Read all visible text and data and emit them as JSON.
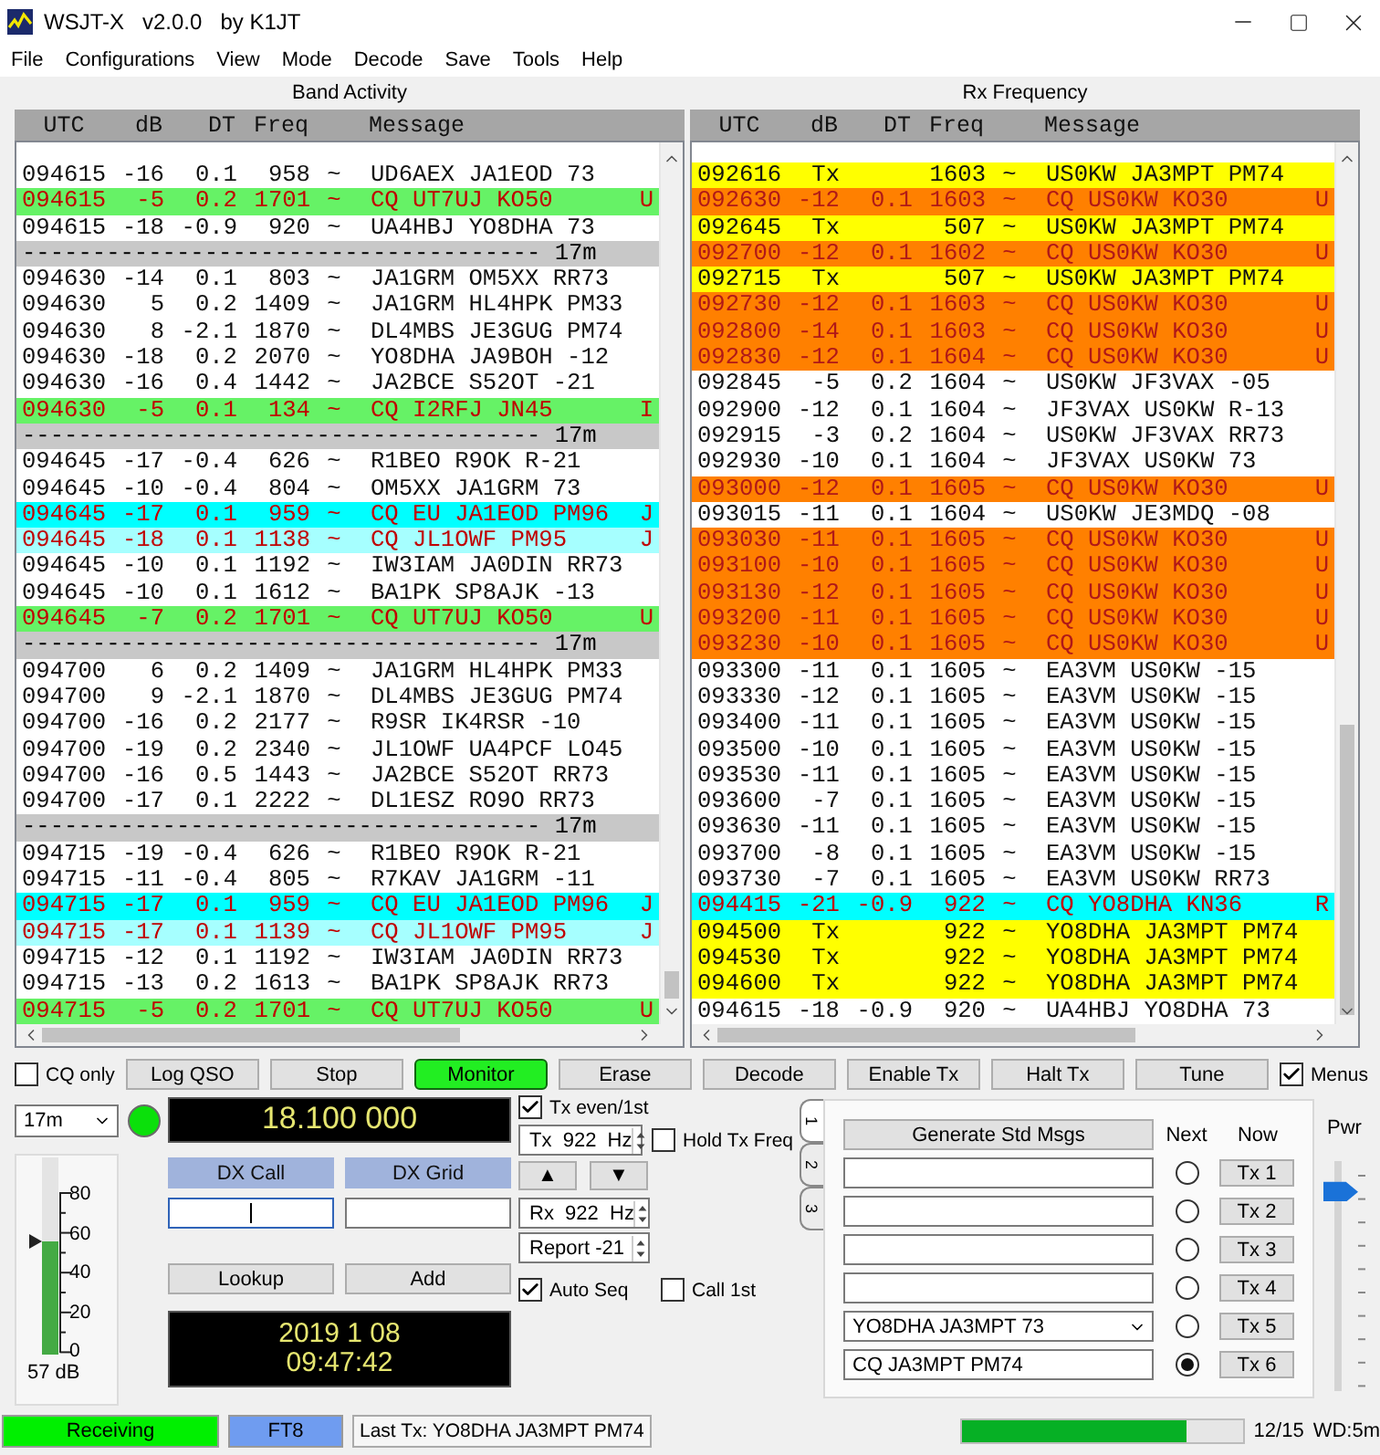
{
  "window": {
    "title": "WSJT-X   v2.0.0   by K1JT"
  },
  "menu": [
    "File",
    "Configurations",
    "View",
    "Mode",
    "Decode",
    "Save",
    "Tools",
    "Help"
  ],
  "panels": [
    {
      "title": "Band Activity",
      "columns": [
        "UTC",
        "dB",
        "DT",
        "Freq",
        "Message"
      ],
      "rows": [
        {
          "kind": "plain",
          "utc": "094615",
          "db": "-16",
          "dt": "0.1",
          "freq": "958",
          "mark": "~",
          "message": "UD6AEX JA1EOD 73"
        },
        {
          "kind": "cq",
          "utc": "094615",
          "db": "-5",
          "dt": "0.2",
          "freq": "1701",
          "mark": "~",
          "message": "CQ UT7UJ KO50",
          "tail": "U"
        },
        {
          "kind": "plain",
          "utc": "094615",
          "db": "-18",
          "dt": "-0.9",
          "freq": "920",
          "mark": "~",
          "message": "UA4HBJ YO8DHA 73"
        },
        {
          "kind": "separator",
          "text": "------------------------------------- 17m"
        },
        {
          "kind": "plain",
          "utc": "094630",
          "db": "-14",
          "dt": "0.1",
          "freq": "803",
          "mark": "~",
          "message": "JA1GRM OM5XX RR73"
        },
        {
          "kind": "plain",
          "utc": "094630",
          "db": "5",
          "dt": "0.2",
          "freq": "1409",
          "mark": "~",
          "message": "JA1GRM HL4HPK PM33"
        },
        {
          "kind": "plain",
          "utc": "094630",
          "db": "8",
          "dt": "-2.1",
          "freq": "1870",
          "mark": "~",
          "message": "DL4MBS JE3GUG PM74"
        },
        {
          "kind": "plain",
          "utc": "094630",
          "db": "-18",
          "dt": "0.2",
          "freq": "2070",
          "mark": "~",
          "message": "YO8DHA JA9BOH -12"
        },
        {
          "kind": "plain",
          "utc": "094630",
          "db": "-16",
          "dt": "0.4",
          "freq": "1442",
          "mark": "~",
          "message": "JA2BCE S52OT -21"
        },
        {
          "kind": "cq",
          "utc": "094630",
          "db": "-5",
          "dt": "0.1",
          "freq": "134",
          "mark": "~",
          "message": "CQ I2RFJ JN45",
          "tail": "I"
        },
        {
          "kind": "separator",
          "text": "------------------------------------- 17m"
        },
        {
          "kind": "plain",
          "utc": "094645",
          "db": "-17",
          "dt": "-0.4",
          "freq": "626",
          "mark": "~",
          "message": "R1BEO R9OK R-21"
        },
        {
          "kind": "plain",
          "utc": "094645",
          "db": "-10",
          "dt": "-0.4",
          "freq": "804",
          "mark": "~",
          "message": "OM5XX JA1GRM 73"
        },
        {
          "kind": "dxcc",
          "utc": "094645",
          "db": "-17",
          "dt": "0.1",
          "freq": "959",
          "mark": "~",
          "message": "CQ EU JA1EOD PM96",
          "tail": "J"
        },
        {
          "kind": "call",
          "utc": "094645",
          "db": "-18",
          "dt": "0.1",
          "freq": "1138",
          "mark": "~",
          "message": "CQ JL1OWF PM95",
          "tail": "J"
        },
        {
          "kind": "plain",
          "utc": "094645",
          "db": "-10",
          "dt": "0.1",
          "freq": "1192",
          "mark": "~",
          "message": "IW3IAM JA0DIN RR73"
        },
        {
          "kind": "plain",
          "utc": "094645",
          "db": "-10",
          "dt": "0.1",
          "freq": "1612",
          "mark": "~",
          "message": "BA1PK SP8AJK -13"
        },
        {
          "kind": "cq",
          "utc": "094645",
          "db": "-7",
          "dt": "0.2",
          "freq": "1701",
          "mark": "~",
          "message": "CQ UT7UJ KO50",
          "tail": "U"
        },
        {
          "kind": "separator",
          "text": "------------------------------------- 17m"
        },
        {
          "kind": "plain",
          "utc": "094700",
          "db": "6",
          "dt": "0.2",
          "freq": "1409",
          "mark": "~",
          "message": "JA1GRM HL4HPK PM33"
        },
        {
          "kind": "plain",
          "utc": "094700",
          "db": "9",
          "dt": "-2.1",
          "freq": "1870",
          "mark": "~",
          "message": "DL4MBS JE3GUG PM74"
        },
        {
          "kind": "plain",
          "utc": "094700",
          "db": "-16",
          "dt": "0.2",
          "freq": "2177",
          "mark": "~",
          "message": "R9SR IK4RSR -10"
        },
        {
          "kind": "plain",
          "utc": "094700",
          "db": "-19",
          "dt": "0.2",
          "freq": "2340",
          "mark": "~",
          "message": "JL1OWF UA4PCF LO45"
        },
        {
          "kind": "plain",
          "utc": "094700",
          "db": "-16",
          "dt": "0.5",
          "freq": "1443",
          "mark": "~",
          "message": "JA2BCE S52OT RR73"
        },
        {
          "kind": "plain",
          "utc": "094700",
          "db": "-17",
          "dt": "0.1",
          "freq": "2222",
          "mark": "~",
          "message": "DL1ESZ RO9O RR73"
        },
        {
          "kind": "separator",
          "text": "------------------------------------- 17m"
        },
        {
          "kind": "plain",
          "utc": "094715",
          "db": "-19",
          "dt": "-0.4",
          "freq": "626",
          "mark": "~",
          "message": "R1BEO R9OK R-21"
        },
        {
          "kind": "plain",
          "utc": "094715",
          "db": "-11",
          "dt": "-0.4",
          "freq": "805",
          "mark": "~",
          "message": "R7KAV JA1GRM -11"
        },
        {
          "kind": "dxcc",
          "utc": "094715",
          "db": "-17",
          "dt": "0.1",
          "freq": "959",
          "mark": "~",
          "message": "CQ EU JA1EOD PM96",
          "tail": "J"
        },
        {
          "kind": "call",
          "utc": "094715",
          "db": "-17",
          "dt": "0.1",
          "freq": "1139",
          "mark": "~",
          "message": "CQ JL1OWF PM95",
          "tail": "J"
        },
        {
          "kind": "plain",
          "utc": "094715",
          "db": "-12",
          "dt": "0.1",
          "freq": "1192",
          "mark": "~",
          "message": "IW3IAM JA0DIN RR73"
        },
        {
          "kind": "plain",
          "utc": "094715",
          "db": "-13",
          "dt": "0.2",
          "freq": "1613",
          "mark": "~",
          "message": "BA1PK SP8AJK RR73"
        },
        {
          "kind": "cq",
          "utc": "094715",
          "db": "-5",
          "dt": "0.2",
          "freq": "1701",
          "mark": "~",
          "message": "CQ UT7UJ KO50",
          "tail": "U"
        }
      ]
    },
    {
      "title": "Rx Frequency",
      "columns": [
        "UTC",
        "dB",
        "DT",
        "Freq",
        "Message"
      ],
      "rows": [
        {
          "kind": "tx",
          "utc": "092616",
          "db": "Tx",
          "freq": "1603",
          "mark": "~",
          "message": "US0KW JA3MPT PM74"
        },
        {
          "kind": "watch",
          "utc": "092630",
          "db": "-12",
          "dt": "0.1",
          "freq": "1603",
          "mark": "~",
          "message": "CQ US0KW KO30",
          "tail": "U"
        },
        {
          "kind": "tx",
          "utc": "092645",
          "db": "Tx",
          "freq": "507",
          "mark": "~",
          "message": "US0KW JA3MPT PM74"
        },
        {
          "kind": "watch",
          "utc": "092700",
          "db": "-12",
          "dt": "0.1",
          "freq": "1602",
          "mark": "~",
          "message": "CQ US0KW KO30",
          "tail": "U"
        },
        {
          "kind": "tx",
          "utc": "092715",
          "db": "Tx",
          "freq": "507",
          "mark": "~",
          "message": "US0KW JA3MPT PM74"
        },
        {
          "kind": "watch",
          "utc": "092730",
          "db": "-12",
          "dt": "0.1",
          "freq": "1603",
          "mark": "~",
          "message": "CQ US0KW KO30",
          "tail": "U"
        },
        {
          "kind": "watch",
          "utc": "092800",
          "db": "-14",
          "dt": "0.1",
          "freq": "1603",
          "mark": "~",
          "message": "CQ US0KW KO30",
          "tail": "U"
        },
        {
          "kind": "watch",
          "utc": "092830",
          "db": "-12",
          "dt": "0.1",
          "freq": "1604",
          "mark": "~",
          "message": "CQ US0KW KO30",
          "tail": "U"
        },
        {
          "kind": "plain",
          "utc": "092845",
          "db": "-5",
          "dt": "0.2",
          "freq": "1604",
          "mark": "~",
          "message": "US0KW JF3VAX -05"
        },
        {
          "kind": "plain",
          "utc": "092900",
          "db": "-12",
          "dt": "0.1",
          "freq": "1604",
          "mark": "~",
          "message": "JF3VAX US0KW R-13"
        },
        {
          "kind": "plain",
          "utc": "092915",
          "db": "-3",
          "dt": "0.2",
          "freq": "1604",
          "mark": "~",
          "message": "US0KW JF3VAX RR73"
        },
        {
          "kind": "plain",
          "utc": "092930",
          "db": "-10",
          "dt": "0.1",
          "freq": "1604",
          "mark": "~",
          "message": "JF3VAX US0KW 73"
        },
        {
          "kind": "watch",
          "utc": "093000",
          "db": "-12",
          "dt": "0.1",
          "freq": "1605",
          "mark": "~",
          "message": "CQ US0KW KO30",
          "tail": "U"
        },
        {
          "kind": "plain",
          "utc": "093015",
          "db": "-11",
          "dt": "0.1",
          "freq": "1604",
          "mark": "~",
          "message": "US0KW JE3MDQ -08"
        },
        {
          "kind": "watch",
          "utc": "093030",
          "db": "-11",
          "dt": "0.1",
          "freq": "1605",
          "mark": "~",
          "message": "CQ US0KW KO30",
          "tail": "U"
        },
        {
          "kind": "watch",
          "utc": "093100",
          "db": "-10",
          "dt": "0.1",
          "freq": "1605",
          "mark": "~",
          "message": "CQ US0KW KO30",
          "tail": "U"
        },
        {
          "kind": "watch",
          "utc": "093130",
          "db": "-12",
          "dt": "0.1",
          "freq": "1605",
          "mark": "~",
          "message": "CQ US0KW KO30",
          "tail": "U"
        },
        {
          "kind": "watch",
          "utc": "093200",
          "db": "-11",
          "dt": "0.1",
          "freq": "1605",
          "mark": "~",
          "message": "CQ US0KW KO30",
          "tail": "U"
        },
        {
          "kind": "watch",
          "utc": "093230",
          "db": "-10",
          "dt": "0.1",
          "freq": "1605",
          "mark": "~",
          "message": "CQ US0KW KO30",
          "tail": "U"
        },
        {
          "kind": "plain",
          "utc": "093300",
          "db": "-11",
          "dt": "0.1",
          "freq": "1605",
          "mark": "~",
          "message": "EA3VM US0KW -15"
        },
        {
          "kind": "plain",
          "utc": "093330",
          "db": "-12",
          "dt": "0.1",
          "freq": "1605",
          "mark": "~",
          "message": "EA3VM US0KW -15"
        },
        {
          "kind": "plain",
          "utc": "093400",
          "db": "-11",
          "dt": "0.1",
          "freq": "1605",
          "mark": "~",
          "message": "EA3VM US0KW -15"
        },
        {
          "kind": "plain",
          "utc": "093500",
          "db": "-10",
          "dt": "0.1",
          "freq": "1605",
          "mark": "~",
          "message": "EA3VM US0KW -15"
        },
        {
          "kind": "plain",
          "utc": "093530",
          "db": "-11",
          "dt": "0.1",
          "freq": "1605",
          "mark": "~",
          "message": "EA3VM US0KW -15"
        },
        {
          "kind": "plain",
          "utc": "093600",
          "db": "-7",
          "dt": "0.1",
          "freq": "1605",
          "mark": "~",
          "message": "EA3VM US0KW -15"
        },
        {
          "kind": "plain",
          "utc": "093630",
          "db": "-11",
          "dt": "0.1",
          "freq": "1605",
          "mark": "~",
          "message": "EA3VM US0KW -15"
        },
        {
          "kind": "plain",
          "utc": "093700",
          "db": "-8",
          "dt": "0.1",
          "freq": "1605",
          "mark": "~",
          "message": "EA3VM US0KW -15"
        },
        {
          "kind": "plain",
          "utc": "093730",
          "db": "-7",
          "dt": "0.1",
          "freq": "1605",
          "mark": "~",
          "message": "EA3VM US0KW RR73"
        },
        {
          "kind": "dxcc",
          "utc": "094415",
          "db": "-21",
          "dt": "-0.9",
          "freq": "922",
          "mark": "~",
          "message": "CQ YO8DHA KN36",
          "tail": "R"
        },
        {
          "kind": "tx",
          "utc": "094500",
          "db": "Tx",
          "freq": "922",
          "mark": "~",
          "message": "YO8DHA JA3MPT PM74"
        },
        {
          "kind": "tx",
          "utc": "094530",
          "db": "Tx",
          "freq": "922",
          "mark": "~",
          "message": "YO8DHA JA3MPT PM74"
        },
        {
          "kind": "tx",
          "utc": "094600",
          "db": "Tx",
          "freq": "922",
          "mark": "~",
          "message": "YO8DHA JA3MPT PM74"
        },
        {
          "kind": "plain",
          "utc": "094615",
          "db": "-18",
          "dt": "-0.9",
          "freq": "920",
          "mark": "~",
          "message": "UA4HBJ YO8DHA 73"
        }
      ]
    }
  ],
  "controls": {
    "cq_only": {
      "label": "CQ only",
      "checked": false
    },
    "buttons": [
      {
        "label": "Log QSO",
        "on": false
      },
      {
        "label": "Stop",
        "on": false
      },
      {
        "label": "Monitor",
        "on": true
      },
      {
        "label": "Erase",
        "on": false
      },
      {
        "label": "Decode",
        "on": false
      },
      {
        "label": "Enable Tx",
        "on": false
      },
      {
        "label": "Halt Tx",
        "on": false
      },
      {
        "label": "Tune",
        "on": false
      }
    ],
    "menus": {
      "label": "Menus",
      "checked": true
    }
  },
  "band": {
    "value": "17m"
  },
  "signal": {
    "level": 0.57,
    "reading": "57 dB",
    "scale": [
      "80",
      "60",
      "40",
      "20",
      "0"
    ]
  },
  "dial_frequency": "18.100 000",
  "dx": {
    "call_label": "DX Call",
    "grid_label": "DX Grid",
    "call_focused": true,
    "lookup": "Lookup",
    "add": "Add"
  },
  "clock": {
    "date": "2019 1 08",
    "time": "09:47:42"
  },
  "tx": {
    "even_first": {
      "label": "Tx even/1st",
      "checked": true
    },
    "tx_freq": "Tx  922  Hz",
    "hold": {
      "label": "Hold Tx Freq",
      "checked": false
    },
    "arrows": [
      "▲",
      "▼"
    ],
    "rx_freq": "Rx  922  Hz",
    "report": "Report -21",
    "auto_seq": {
      "label": "Auto Seq",
      "checked": true
    },
    "call_first": {
      "label": "Call 1st",
      "checked": false
    }
  },
  "messages": {
    "tabs": [
      {
        "label": "1",
        "selected": true
      },
      {
        "label": "2",
        "selected": false
      },
      {
        "label": "3",
        "selected": false
      }
    ],
    "generate": "Generate Std Msgs",
    "next": "Next",
    "now": "Now",
    "rows": [
      {
        "kind": "field",
        "selected": false,
        "button": "Tx 1"
      },
      {
        "kind": "field",
        "selected": false,
        "button": "Tx 2"
      },
      {
        "kind": "field",
        "selected": false,
        "button": "Tx 3"
      },
      {
        "kind": "field",
        "selected": false,
        "button": "Tx 4"
      },
      {
        "kind": "dropdown",
        "value": "YO8DHA JA3MPT 73",
        "selected": false,
        "button": "Tx 5"
      },
      {
        "kind": "field",
        "value": "CQ JA3MPT PM74",
        "selected": true,
        "button": "Tx 6"
      }
    ]
  },
  "power": {
    "label": "Pwr",
    "level": 0.91
  },
  "status_bar": {
    "state": "Receiving",
    "mode": "FT8",
    "last_tx": "Last Tx: YO8DHA JA3MPT PM74",
    "progress": {
      "level": 0.8
    },
    "period": "12/15",
    "watchdog": "WD:5m"
  }
}
